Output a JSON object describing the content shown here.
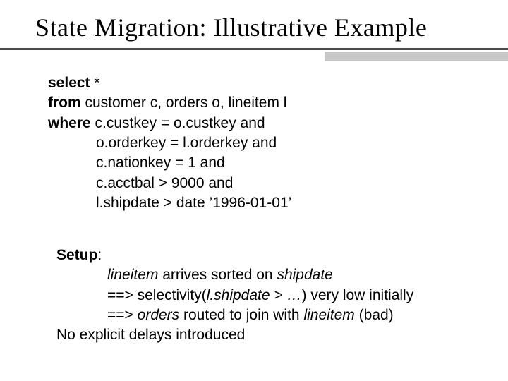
{
  "title": "State Migration: Illustrative Example",
  "sql": {
    "kw_select": "select",
    "star": " *",
    "kw_from": "from",
    "from_rest": "  customer c, orders o, lineitem l",
    "kw_where": "where",
    "where_first": " c.custkey = o.custkey and",
    "where_lines": [
      "o.orderkey = l.orderkey and",
      "c.nationkey = 1 and",
      "c.acctbal > 9000 and",
      "l.shipdate > date ’1996-01-01’"
    ]
  },
  "setup": {
    "label": "Setup",
    "colon": ":",
    "line1_a": "lineitem",
    "line1_b": " arrives sorted on ",
    "line1_c": "shipdate",
    "line2_a": "==> selectivity(",
    "line2_b": "l.shipdate > …",
    "line2_c": ") very low initially",
    "line3_a": "==> ",
    "line3_b": "orders",
    "line3_c": " routed to join with ",
    "line3_d": "lineitem",
    "line3_e": " (bad)",
    "line4": "No explicit delays introduced"
  }
}
